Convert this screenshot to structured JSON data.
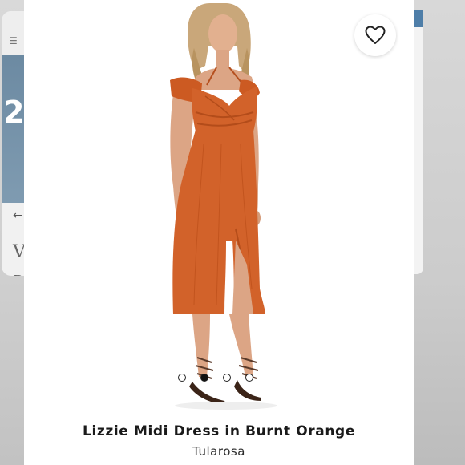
{
  "background_left": {
    "menu_icon": "menu-icon",
    "big_text": "2",
    "arrow": "←",
    "letter_v": "V",
    "letter_d": "D"
  },
  "product": {
    "image_alt": "Model wearing orange off-shoulder midi dress",
    "active_image_index": 1,
    "image_count": 4,
    "title": "Lizzie Midi Dress in Burnt Orange",
    "brand": "Tularosa",
    "favorite_icon": "heart-icon",
    "dress_color": "#d2622a"
  }
}
